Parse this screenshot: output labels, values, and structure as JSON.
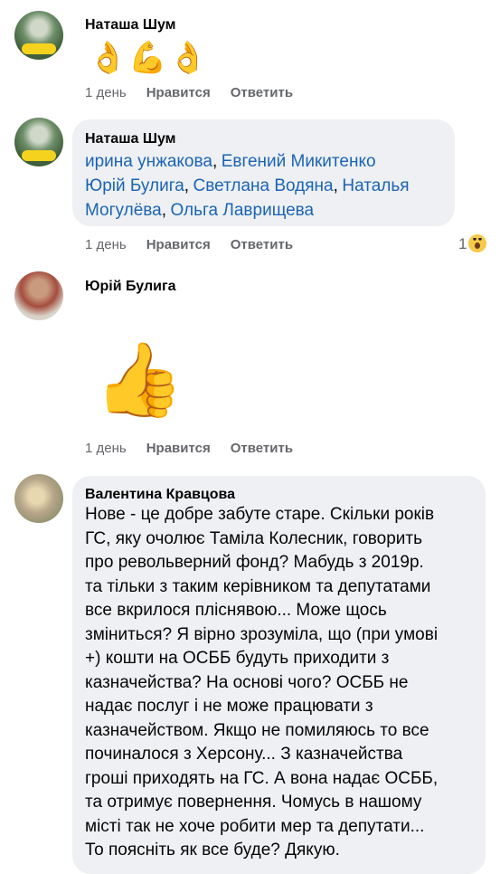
{
  "comments": [
    {
      "author": "Наташа Шум",
      "emojis": "👌💪👌",
      "time": "1 день",
      "like": "Нравится",
      "reply": "Ответить"
    },
    {
      "author": "Наташа Шум",
      "mentions": [
        "ирина унжакова",
        "Евгений Микитенко",
        "Юрій Булига",
        "Светлана Водяна",
        "Наталья Могулёва",
        "Ольга Лаврищева"
      ],
      "separator": ",",
      "time": "1 день",
      "like": "Нравится",
      "reply": "Ответить",
      "reaction_count": "1",
      "reaction_icon": "wow-icon"
    },
    {
      "author": "Юрій Булига",
      "sticker": "👍",
      "time": "1 день",
      "like": "Нравится",
      "reply": "Ответить"
    },
    {
      "author": "Валентина Кравцова",
      "lines": [
        "Нове - це добре забуте старе. Скільки років",
        "ГС, яку очолює Таміла Колесник, говорить",
        "про револьверний фонд? Мабудь з 2019р.",
        "та тільки з таким керівником та депутатами",
        "все вкрилося пліснявою... Може щось",
        "зміниться? Я вірно зрозуміла, що (при умові",
        "+) кошти на ОСББ будуть приходити з",
        "казначейства? На основі чого? ОСББ не",
        "надає послуг і не може працювати з",
        "казначейством. Якщо не помиляюсь то все",
        "починалося з Херсону... З казначейства",
        "гроші приходять на ГС. А вона надає ОСББ,",
        "та отримує повернення. Чомусь в нашому",
        "місті так не хоче робити мер та депутати...",
        "То поясніть як все буде? Дякую."
      ]
    }
  ]
}
